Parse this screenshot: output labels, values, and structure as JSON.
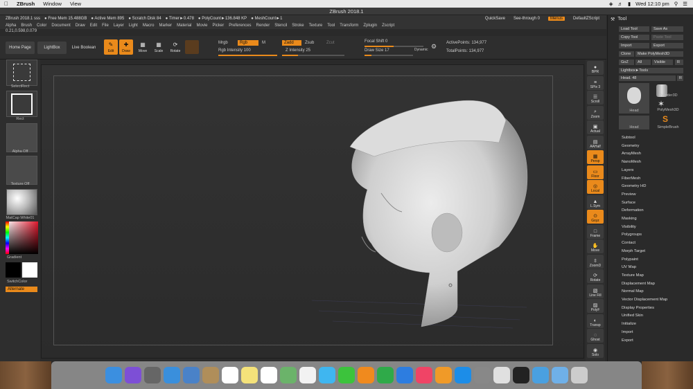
{
  "mac_menu": {
    "app": "ZBrush",
    "items": [
      "Window",
      "View"
    ],
    "clock": "Wed 12:10 pm"
  },
  "window_title": "ZBrush 2018.1",
  "info_bar": {
    "segments": [
      "ZBrush 2018.1 sss",
      "● Free Mem 15.488GB",
      "● Active Mem 895",
      "● Scratch Disk 84",
      "● Timer►0.478",
      "● PolyCount►136.848 KP",
      "● MeshCount►1"
    ],
    "quicksave": "QuickSave",
    "seethrough": "See-through  0",
    "menus": "Menus",
    "defaultzscript": "DefaultZScript"
  },
  "menu_items": [
    "Alpha",
    "Brush",
    "Color",
    "Document",
    "Draw",
    "Edit",
    "File",
    "Layer",
    "Light",
    "Macro",
    "Marker",
    "Material",
    "Movie",
    "Picker",
    "Preferences",
    "Render",
    "Stencil",
    "Stroke",
    "Texture",
    "Tool",
    "Transform",
    "Zplugin",
    "Zscript"
  ],
  "coords": "0.21,0.598,0.079",
  "shelf": {
    "home_page": "Home Page",
    "lightbox": "LightBox",
    "live_boolean": "Live Boolean",
    "tools": [
      {
        "label": "Edit",
        "on": true
      },
      {
        "label": "Draw",
        "on": true
      },
      {
        "label": "Move",
        "on": false
      },
      {
        "label": "Scale",
        "on": false
      },
      {
        "label": "Rotate",
        "on": false
      }
    ],
    "mrgb": "Mrgb",
    "rgb": "Rgb",
    "m": "M",
    "rgb_intensity": "Rgb Intensity 100",
    "zadd": "Zadd",
    "zsub": "Zsub",
    "zcut": "Zcut",
    "z_intensity": "Z Intensity 25",
    "focal_shift": "Focal Shift 0",
    "draw_size": "Draw Size 17",
    "dynamic": "Dynamic",
    "active_points": "ActivePoints: 134,977",
    "total_points": "TotalPoints: 134,977"
  },
  "left_panel": {
    "select_rect": "SelectRect",
    "rect": "Rect",
    "alpha": "Alpha Off",
    "texture": "Texture Off",
    "matcap": "MatCap White01",
    "gradient": "Gradient",
    "switchcolor": "SwitchColor",
    "alternate": "Alternate"
  },
  "right_strip": [
    {
      "label": "BPR",
      "on": false
    },
    {
      "label": "SPix 3",
      "on": false
    },
    {
      "label": "Scroll",
      "on": false
    },
    {
      "label": "Zoom",
      "on": false
    },
    {
      "label": "Actual",
      "on": false
    },
    {
      "label": "AAHalf",
      "on": false
    },
    {
      "label": "Persp",
      "on": true
    },
    {
      "label": "Floor",
      "on": true
    },
    {
      "label": "Local",
      "on": true
    },
    {
      "label": "L.Sym",
      "on": false
    },
    {
      "label": "Gxyz",
      "on": true
    },
    {
      "label": "Frame",
      "on": false
    },
    {
      "label": "Move",
      "on": false
    },
    {
      "label": "ZoomD",
      "on": false
    },
    {
      "label": "Rotate",
      "on": false
    },
    {
      "label": "Line Fill",
      "on": false
    },
    {
      "label": "PolyF",
      "on": false
    },
    {
      "label": "Transp",
      "on": false
    },
    {
      "label": "Ghost",
      "on": false
    },
    {
      "label": "Solo",
      "on": false
    }
  ],
  "tool_panel": {
    "title": "Tool",
    "buttons": [
      [
        "Load Tool",
        "Save As"
      ],
      [
        "Copy Tool",
        "Paste Tool"
      ],
      [
        "Import",
        "Export"
      ],
      [
        "Clone",
        "Make PolyMesh3D"
      ],
      [
        "GoZ",
        "All",
        "Visible",
        "R"
      ]
    ],
    "lightbox_tools": "Lightbox►Tools",
    "head_slider": "Head. 48",
    "thumbs": [
      "Head",
      "Cylinder3D",
      "PolyMesh3D",
      "Head",
      "SimpleBrush"
    ],
    "list": [
      "Subtool",
      "Geometry",
      "ArrayMesh",
      "NanoMesh",
      "Layers",
      "FiberMesh",
      "Geometry HD",
      "Preview",
      "Surface",
      "Deformation",
      "Masking",
      "Visibility",
      "Polygroups",
      "Contact",
      "Morph Target",
      "Polypaint",
      "UV Map",
      "Texture Map",
      "Displacement Map",
      "Normal Map",
      "Vector Displacement Map",
      "Display Properties",
      "Unified Skin",
      "Initialize",
      "Import",
      "Export"
    ]
  },
  "dock_icons": [
    "finder-icon",
    "siri-icon",
    "launchpad-icon",
    "safari-icon",
    "mail-icon",
    "contacts-icon",
    "calendar-icon",
    "notes-icon",
    "reminders-icon",
    "maps-icon",
    "photos-icon",
    "messages-icon",
    "facetime-icon",
    "pages-icon",
    "numbers-icon",
    "keynote-icon",
    "itunes-icon",
    "ibooks-icon",
    "appstore-icon",
    "preferences-icon",
    "chrome-icon",
    "zbrush-icon",
    "downloads-icon",
    "folder-icon",
    "trash-icon"
  ]
}
